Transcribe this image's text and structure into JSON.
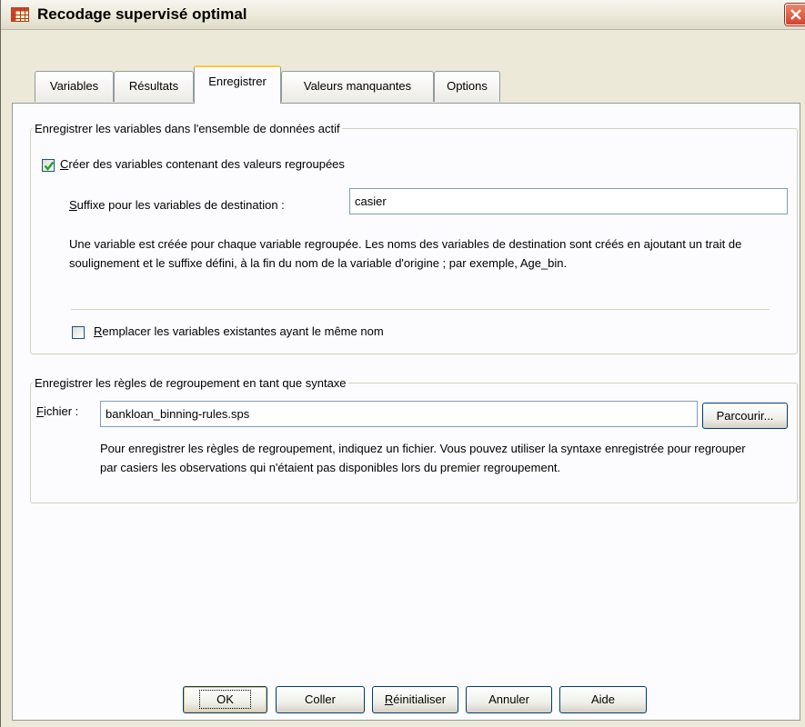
{
  "window": {
    "title": "Recodage supervisé optimal"
  },
  "tabs": [
    {
      "label": "Variables",
      "active": false
    },
    {
      "label": "Résultats",
      "active": false
    },
    {
      "label": "Enregistrer",
      "active": true
    },
    {
      "label": "Valeurs manquantes",
      "active": false
    },
    {
      "label": "Options",
      "active": false
    }
  ],
  "save_variables_group": {
    "legend": "Enregistrer les variables dans l'ensemble de données actif",
    "create_checkbox": {
      "label": "Créer des variables contenant des valeurs regroupées",
      "checked": true
    },
    "suffix": {
      "label": "Suffixe pour les variables de destination :",
      "value": "casier"
    },
    "description": "Une variable est créée pour chaque variable regroupée. Les noms des variables de destination sont créés en ajoutant un trait de soulignement et le suffixe défini, à la fin du nom de la variable d'origine ; par exemple, Age_bin.",
    "replace_checkbox": {
      "label": "Remplacer les variables existantes ayant le même nom",
      "checked": false
    }
  },
  "save_rules_group": {
    "legend": "Enregistrer les règles de regroupement en tant que syntaxe",
    "file_label": "Fichier :",
    "file_value": "bankloan_binning-rules.sps",
    "browse_label": "Parcourir...",
    "description": "Pour enregistrer les règles de regroupement, indiquez un fichier. Vous pouvez utiliser la syntaxe enregistrée pour regrouper par casiers les observations qui n'étaient pas disponibles lors du premier regroupement."
  },
  "buttons": {
    "ok": "OK",
    "paste": "Coller",
    "reset": "Réinitialiser",
    "cancel": "Annuler",
    "help": "Aide"
  },
  "colors": {
    "dialog_bg": "#ece9d8",
    "panel_bg": "#fcfcfe",
    "accent_tab": "#ffc83c",
    "check_mark": "#21a121"
  }
}
